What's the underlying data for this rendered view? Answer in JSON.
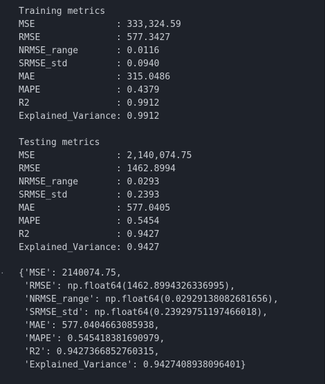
{
  "stdout": {
    "training_title": "Training metrics",
    "training_lines": [
      "MSE               : 333,324.59",
      "RMSE              : 577.3427",
      "NRMSE_range       : 0.0116",
      "SRMSE_std         : 0.0940",
      "MAE               : 315.0486",
      "MAPE              : 0.4379",
      "R2                : 0.9912",
      "Explained_Variance: 0.9912"
    ],
    "testing_title": "Testing metrics",
    "testing_lines": [
      "MSE               : 2,140,074.75",
      "RMSE              : 1462.8994",
      "NRMSE_range       : 0.0293",
      "SRMSE_std         : 0.2393",
      "MAE               : 577.0405",
      "MAPE              : 0.5454",
      "R2                : 0.9427",
      "Explained_Variance: 0.9427"
    ]
  },
  "result": {
    "prompt_marker": "·",
    "lines": [
      "{'MSE': 2140074.75,",
      " 'RMSE': np.float64(1462.8994326336995),",
      " 'NRMSE_range': np.float64(0.02929138082681656),",
      " 'SRMSE_std': np.float64(0.23929751197466018),",
      " 'MAE': 577.0404663085938,",
      " 'MAPE': 0.545418381690979,",
      " 'R2': 0.9427366852760315,",
      " 'Explained_Variance': 0.9427408938096401}"
    ]
  }
}
